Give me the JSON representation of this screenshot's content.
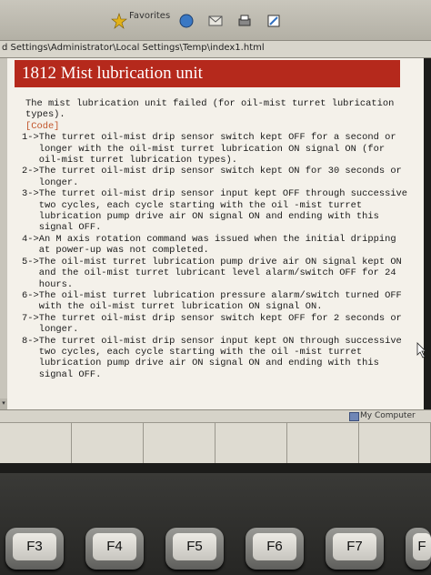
{
  "browser": {
    "toolbar_items": [
      {
        "icon": "star-favorites-icon",
        "label": "Favorites"
      },
      {
        "icon": "media-icon",
        "label": ""
      },
      {
        "icon": "mail-icon",
        "label": ""
      },
      {
        "icon": "print-icon",
        "label": ""
      },
      {
        "icon": "edit-icon",
        "label": ""
      }
    ],
    "address": "d Settings\\Administrator\\Local Settings\\Temp\\index1.html",
    "status_zone": "My Computer"
  },
  "page": {
    "title": "1812 Mist lubrication unit",
    "intro": "The mist lubrication unit failed (for oil-mist turret lubrication types).",
    "code_heading": "[Code]",
    "codes": [
      {
        "num": "1->",
        "text": "The turret oil-mist drip sensor switch kept OFF for a second or longer with the oil-mist turret lubrication ON signal ON (for oil-mist turret lubrication types)."
      },
      {
        "num": "2->",
        "text": "The turret oil-mist drip sensor switch kept ON for 30 seconds or longer."
      },
      {
        "num": "3->",
        "text": "The turret oil-mist drip sensor input kept OFF through successive two cycles, each cycle starting with the oil -mist turret lubrication pump drive air ON signal ON and ending with this signal OFF."
      },
      {
        "num": "4->",
        "text": "An M axis rotation command was issued when the initial dripping at power-up was not completed."
      },
      {
        "num": "5->",
        "text": "The oil-mist turret lubrication pump drive air ON signal kept ON and the oil-mist turret lubricant level alarm/switch OFF for 24 hours."
      },
      {
        "num": "6->",
        "text": "The oil-mist turret lubrication pressure alarm/switch turned OFF with the oil-mist turret lubrication ON signal ON."
      },
      {
        "num": "7->",
        "text": "The turret oil-mist drip sensor switch kept OFF for 2 seconds or longer."
      },
      {
        "num": "8->",
        "text": "The turret oil-mist drip sensor input kept ON through successive two cycles, each cycle starting with the oil -mist turret lubrication pump drive air ON signal ON and ending with this signal OFF."
      }
    ]
  },
  "function_keys": [
    "F3",
    "F4",
    "F5",
    "F6",
    "F7",
    "F"
  ],
  "colors": {
    "title_bar": "#b5291c",
    "code_heading": "#c2562c",
    "page_bg": "#f4f1ea"
  }
}
